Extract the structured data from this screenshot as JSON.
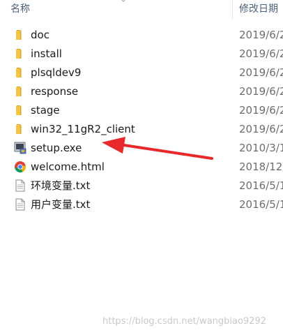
{
  "header": {
    "name_label": "名称",
    "date_label": "修改日期"
  },
  "files": [
    {
      "name": "doc",
      "date": "2019/6/2",
      "icon": "folder-icon"
    },
    {
      "name": "install",
      "date": "2019/6/2",
      "icon": "folder-icon"
    },
    {
      "name": "plsqldev9",
      "date": "2019/6/2",
      "icon": "folder-icon"
    },
    {
      "name": "response",
      "date": "2019/6/2",
      "icon": "folder-icon"
    },
    {
      "name": "stage",
      "date": "2019/6/2",
      "icon": "folder-icon"
    },
    {
      "name": "win32_11gR2_client",
      "date": "2019/6/2",
      "icon": "folder-icon"
    },
    {
      "name": "setup.exe",
      "date": "2010/3/1",
      "icon": "setup-exe-icon"
    },
    {
      "name": "welcome.html",
      "date": "2018/12/",
      "icon": "chrome-icon"
    },
    {
      "name": "环境变量.txt",
      "date": "2016/5/1",
      "icon": "text-file-icon"
    },
    {
      "name": "用户变量.txt",
      "date": "2016/5/1",
      "icon": "text-file-icon"
    }
  ],
  "watermark": "https://blog.csdn.net/wangbiao9292",
  "colors": {
    "folder": "#f4c542",
    "arrow": "#e8282a",
    "header_text": "#4c607a"
  }
}
